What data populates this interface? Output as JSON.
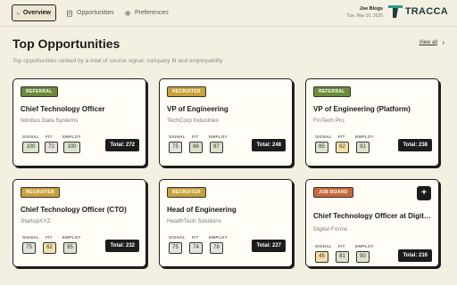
{
  "nav": {
    "overview": "Overview",
    "opportunities": "Opportunities",
    "preferences": "Preferences"
  },
  "user": {
    "name": "Joe Blogs",
    "date": "Tue, Mar 10, 2026"
  },
  "brand": {
    "name": "TRACCA",
    "color": "#1e3d3b"
  },
  "header": {
    "title": "Top Opportunities",
    "view_all": "View all",
    "subtitle": "Top opportunities ranked by a total of source signal, company fit and employability"
  },
  "metric_labels": {
    "signal": "SIGNAL",
    "fit": "FIT",
    "employ": "EMPLOY"
  },
  "cards": [
    {
      "badge": "REFERRAL",
      "title": "Chief Technology Officer",
      "company": "Nimbus Data Systems",
      "signal": "100",
      "fit": "72",
      "employ": "100",
      "total": "Total: 272"
    },
    {
      "badge": "RECRUITER",
      "title": "VP of Engineering",
      "company": "TechCorp Industries",
      "signal": "75",
      "fit": "86",
      "employ": "87",
      "total": "Total: 248"
    },
    {
      "badge": "REFERRAL",
      "title": "VP of Engineering (Platform)",
      "company": "FinTech Pro",
      "signal": "85",
      "fit": "62",
      "employ": "91",
      "total": "Total: 238"
    },
    {
      "badge": "RECRUITER",
      "title": "Chief Technology Officer (CTO)",
      "company": "StartupXYZ",
      "signal": "75",
      "fit": "62",
      "employ": "95",
      "total": "Total: 232"
    },
    {
      "badge": "RECRUITER",
      "title": "Head of Engineering",
      "company": "HealthTech Solutions",
      "signal": "75",
      "fit": "74",
      "employ": "78",
      "total": "Total: 227"
    },
    {
      "badge": "JOB BOARD",
      "title": "Chief Technology Officer at Digital ...",
      "company": "Digital Forms",
      "signal": "45",
      "fit": "81",
      "employ": "90",
      "total": "Total: 216",
      "action": "+"
    }
  ],
  "colors": {
    "background": "#f4f0e1",
    "referral": "#6b8a3a",
    "recruiter": "#c9a13a",
    "job_board": "#c76a3a"
  }
}
